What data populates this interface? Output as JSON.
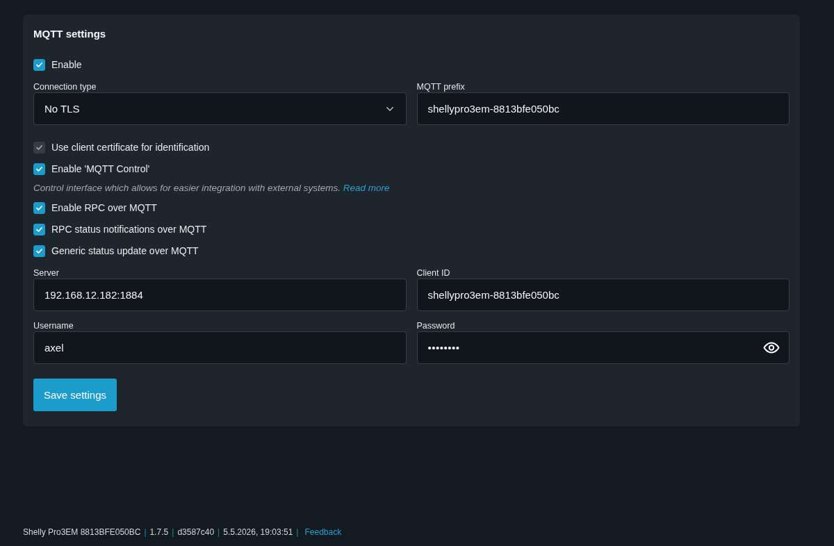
{
  "panel": {
    "title": "MQTT settings",
    "items": [
      {
        "kind": "checkbox",
        "label": "Enable",
        "checked": true,
        "disabled": false
      },
      {
        "kind": "fields",
        "fields": [
          {
            "kind": "select",
            "label": "Connection type",
            "value": "No TLS"
          },
          {
            "kind": "text",
            "label": "MQTT prefix",
            "value": "shellypro3em-8813bfe050bc"
          }
        ]
      },
      {
        "kind": "checkbox",
        "label": "Use client certificate for identification",
        "checked": true,
        "disabled": true
      },
      {
        "kind": "checkbox",
        "label": "Enable 'MQTT Control'",
        "checked": true,
        "disabled": false
      },
      {
        "kind": "note",
        "text": "Control interface which allows for easier integration with external systems.",
        "link": "Read more"
      },
      {
        "kind": "checkbox",
        "label": "Enable RPC over MQTT",
        "checked": true,
        "disabled": false
      },
      {
        "kind": "checkbox",
        "label": "RPC status notifications over MQTT",
        "checked": true,
        "disabled": false
      },
      {
        "kind": "checkbox",
        "label": "Generic status update over MQTT",
        "checked": true,
        "disabled": false
      },
      {
        "kind": "fields",
        "fields": [
          {
            "kind": "text",
            "label": "Server",
            "value": "192.168.12.182:1884"
          },
          {
            "kind": "text",
            "label": "Client ID",
            "value": "shellypro3em-8813bfe050bc"
          }
        ]
      },
      {
        "kind": "fields",
        "fields": [
          {
            "kind": "text",
            "label": "Username",
            "value": "axel"
          },
          {
            "kind": "password",
            "label": "Password",
            "value": "••••••••"
          }
        ]
      },
      {
        "kind": "button",
        "label": "Save settings"
      }
    ]
  },
  "footer": {
    "items": [
      {
        "kind": "text",
        "text": "Shelly Pro3EM 8813BFE050BC"
      },
      {
        "kind": "separator",
        "text": "|"
      },
      {
        "kind": "text",
        "text": "1.7.5"
      },
      {
        "kind": "separator",
        "text": "|"
      },
      {
        "kind": "text",
        "text": "d3587c40"
      },
      {
        "kind": "separator",
        "text": "|"
      },
      {
        "kind": "text",
        "text": "5.5.2026, 19:03:51"
      },
      {
        "kind": "separator",
        "text": "|"
      },
      {
        "kind": "link",
        "text": "Feedback"
      }
    ]
  }
}
